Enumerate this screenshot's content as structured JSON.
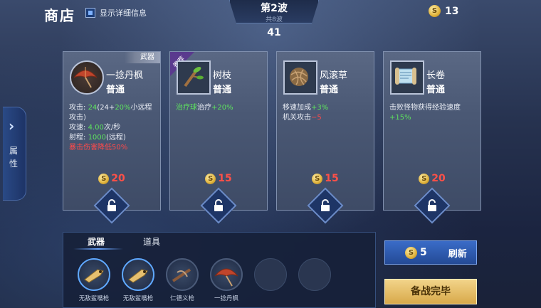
{
  "header": {
    "title": "商店",
    "show_details_label": "显示详细信息",
    "wave_title": "第2波",
    "wave_sub": "共8波",
    "timer": "41",
    "gold": "13"
  },
  "side_tab": {
    "label": "属性"
  },
  "cards": [
    {
      "name": "一捻丹枫",
      "tier": "普通",
      "badge": "武器",
      "icon": "red-umbrella-icon",
      "lines": [
        {
          "parts": [
            {
              "t": "攻击: ",
              "c": ""
            },
            {
              "t": "24",
              "c": "green"
            },
            {
              "t": "(24+",
              "c": ""
            },
            {
              "t": "20%",
              "c": "green"
            },
            {
              "t": "小远程攻击)",
              "c": ""
            }
          ]
        },
        {
          "parts": [
            {
              "t": "攻速: ",
              "c": ""
            },
            {
              "t": "4.00",
              "c": "green"
            },
            {
              "t": "次/秒",
              "c": ""
            }
          ]
        },
        {
          "parts": [
            {
              "t": "射程: ",
              "c": ""
            },
            {
              "t": "1000",
              "c": "green"
            },
            {
              "t": "(远程)",
              "c": ""
            }
          ]
        },
        {
          "parts": [
            {
              "t": "暴击伤害降低50%",
              "c": "red"
            }
          ]
        }
      ],
      "price": "20"
    },
    {
      "name": "树枝",
      "tier": "普通",
      "badge": "推荐",
      "icon": "tree-branch-icon",
      "lines": [
        {
          "parts": [
            {
              "t": "治疗球",
              "c": "green"
            },
            {
              "t": "治疗",
              "c": ""
            },
            {
              "t": "+20%",
              "c": "green"
            }
          ]
        }
      ],
      "price": "15"
    },
    {
      "name": "风滚草",
      "tier": "普通",
      "badge": "",
      "icon": "tumbleweed-icon",
      "lines": [
        {
          "parts": [
            {
              "t": "移速加成",
              "c": ""
            },
            {
              "t": "+3%",
              "c": "green"
            }
          ]
        },
        {
          "parts": [
            {
              "t": "机关攻击",
              "c": ""
            },
            {
              "t": "−5",
              "c": "red"
            }
          ]
        }
      ],
      "price": "15"
    },
    {
      "name": "长卷",
      "tier": "普通",
      "badge": "",
      "icon": "scroll-icon",
      "lines": [
        {
          "parts": [
            {
              "t": "击败怪物获得经验速度",
              "c": ""
            },
            {
              "t": "+15%",
              "c": "green"
            }
          ]
        }
      ],
      "price": "20"
    }
  ],
  "inventory": {
    "tabs": [
      "武器",
      "道具"
    ],
    "active_tab": "武器",
    "slots": [
      {
        "label": "无敌鲨嘴枪",
        "icon": "shark-gun-icon"
      },
      {
        "label": "无敌鲨嘴枪",
        "icon": "shark-gun-icon"
      },
      {
        "label": "仁德义枪",
        "icon": "crossbow-icon"
      },
      {
        "label": "一捻丹枫",
        "icon": "red-umbrella-icon"
      },
      {
        "label": "",
        "icon": ""
      },
      {
        "label": "",
        "icon": ""
      }
    ]
  },
  "actions": {
    "refresh_cost": "5",
    "refresh_label": "刷新",
    "ready_label": "备战完毕"
  },
  "colors": {
    "price": "#ff5048",
    "positive": "#5ee35e",
    "negative": "#ff4a4a",
    "ready_button": "#e8c06a"
  }
}
